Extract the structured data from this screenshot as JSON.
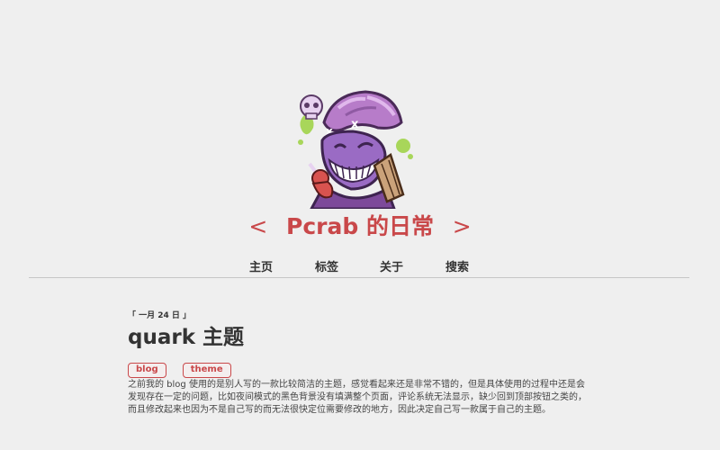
{
  "site": {
    "title_left": "<",
    "title": "Pcrab 的日常",
    "title_right": ">",
    "avatar_icon": "cartoon-monster-avatar",
    "accent_color": "#c9484a"
  },
  "nav": {
    "items": [
      {
        "label": "主页"
      },
      {
        "label": "标签"
      },
      {
        "label": "关于"
      },
      {
        "label": "搜索"
      }
    ]
  },
  "post": {
    "date": "「 一月 24 日 」",
    "title": "quark 主题",
    "tags": [
      {
        "label": "blog"
      },
      {
        "label": "theme"
      }
    ],
    "excerpt": "之前我的 blog 使用的是别人写的一款比较简洁的主题，感觉看起来还是非常不错的，但是具体使用的过程中还是会发现存在一定的问题，比如夜间模式的黑色背景没有填满整个页面，评论系统无法显示，缺少回到顶部按钮之类的，而且修改起来也因为不是自己写的而无法很快定位需要修改的地方，因此决定自己写一款属于自己的主题。"
  }
}
